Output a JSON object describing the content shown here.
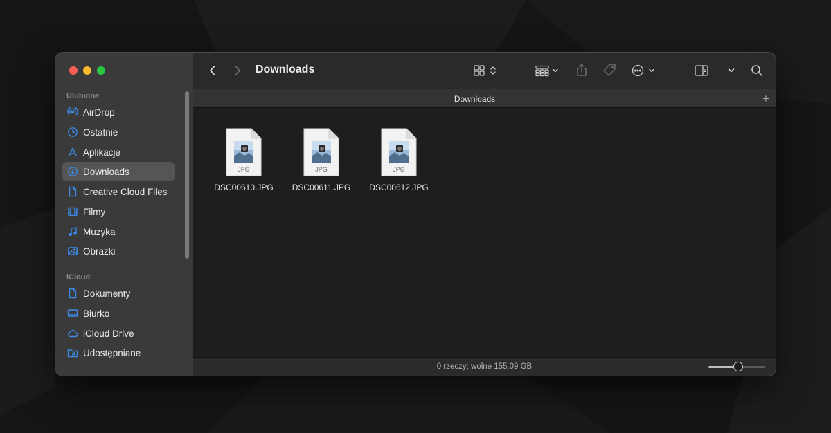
{
  "window": {
    "title": "Downloads",
    "tab_title": "Downloads"
  },
  "colors": {
    "close": "#ff5f57",
    "minimize": "#febc2e",
    "zoom": "#28c840",
    "accent": "#0a84ff",
    "sidebar_icon": "#3b8bea"
  },
  "sidebar": {
    "favorites_label": "Ulubione",
    "favorites": [
      {
        "label": "AirDrop",
        "icon": "airdrop-icon"
      },
      {
        "label": "Ostatnie",
        "icon": "clock-icon"
      },
      {
        "label": "Aplikacje",
        "icon": "applications-icon"
      },
      {
        "label": "Downloads",
        "icon": "download-icon",
        "selected": true
      },
      {
        "label": "Creative Cloud Files",
        "icon": "document-icon"
      },
      {
        "label": "Filmy",
        "icon": "film-icon"
      },
      {
        "label": "Muzyka",
        "icon": "music-icon"
      },
      {
        "label": "Obrazki",
        "icon": "photo-icon"
      }
    ],
    "icloud_label": "iCloud",
    "icloud": [
      {
        "label": "Dokumenty",
        "icon": "document-icon"
      },
      {
        "label": "Biurko",
        "icon": "desktop-icon"
      },
      {
        "label": "iCloud Drive",
        "icon": "cloud-icon"
      },
      {
        "label": "Udostępniane",
        "icon": "shared-folder-icon"
      }
    ]
  },
  "files": [
    {
      "name": "DSC00610.JPG",
      "type_label": "JPG"
    },
    {
      "name": "DSC00611.JPG",
      "type_label": "JPG"
    },
    {
      "name": "DSC00612.JPG",
      "type_label": "JPG"
    }
  ],
  "status": {
    "text": "0 rzeczy; wolne 155,09 GB",
    "zoom_level": 0.52
  }
}
